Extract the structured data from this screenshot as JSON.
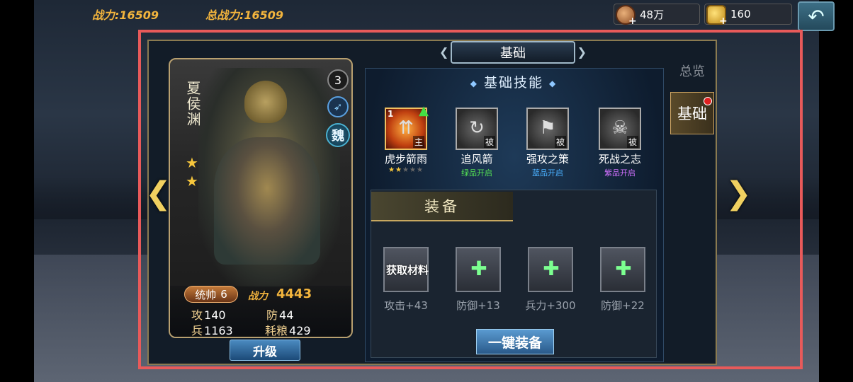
{
  "top": {
    "power_label": "战力:16509",
    "total_power_label": "总战力:16509",
    "coins": "48万",
    "gold": "160"
  },
  "hero": {
    "name": "夏侯渊",
    "level": "3",
    "faction": "魏",
    "commander_label": "统帅",
    "commander_value": "6",
    "battle_power_label": "战力",
    "battle_power": "4443",
    "stats": [
      {
        "label": "攻",
        "value": "140"
      },
      {
        "label": "防",
        "value": "44"
      },
      {
        "label": "兵",
        "value": "1163"
      },
      {
        "label": "耗粮",
        "value": "429"
      }
    ],
    "star_count": 2,
    "upgrade_label": "升级"
  },
  "main_tab_title": "基础",
  "skills": {
    "title": "基础技能",
    "items": [
      {
        "name": "虎步箭雨",
        "tag": "主",
        "level": "1",
        "sub": "",
        "stars_on": 2,
        "stars_total": 5
      },
      {
        "name": "追风箭",
        "tag": "被",
        "sub": "绿品开启"
      },
      {
        "name": "强攻之策",
        "tag": "被",
        "sub": "蓝品开启"
      },
      {
        "name": "死战之志",
        "tag": "被",
        "sub": "紫品开启"
      }
    ]
  },
  "equipment": {
    "tab_label": "装备",
    "obtain_label": "获取材料",
    "items": [
      {
        "label": "攻击+43"
      },
      {
        "label": "防御+13"
      },
      {
        "label": "兵力+300"
      },
      {
        "label": "防御+22"
      }
    ],
    "one_key_label": "一键装备"
  },
  "side_tabs": [
    {
      "label": "总览"
    },
    {
      "label": "基础"
    }
  ]
}
